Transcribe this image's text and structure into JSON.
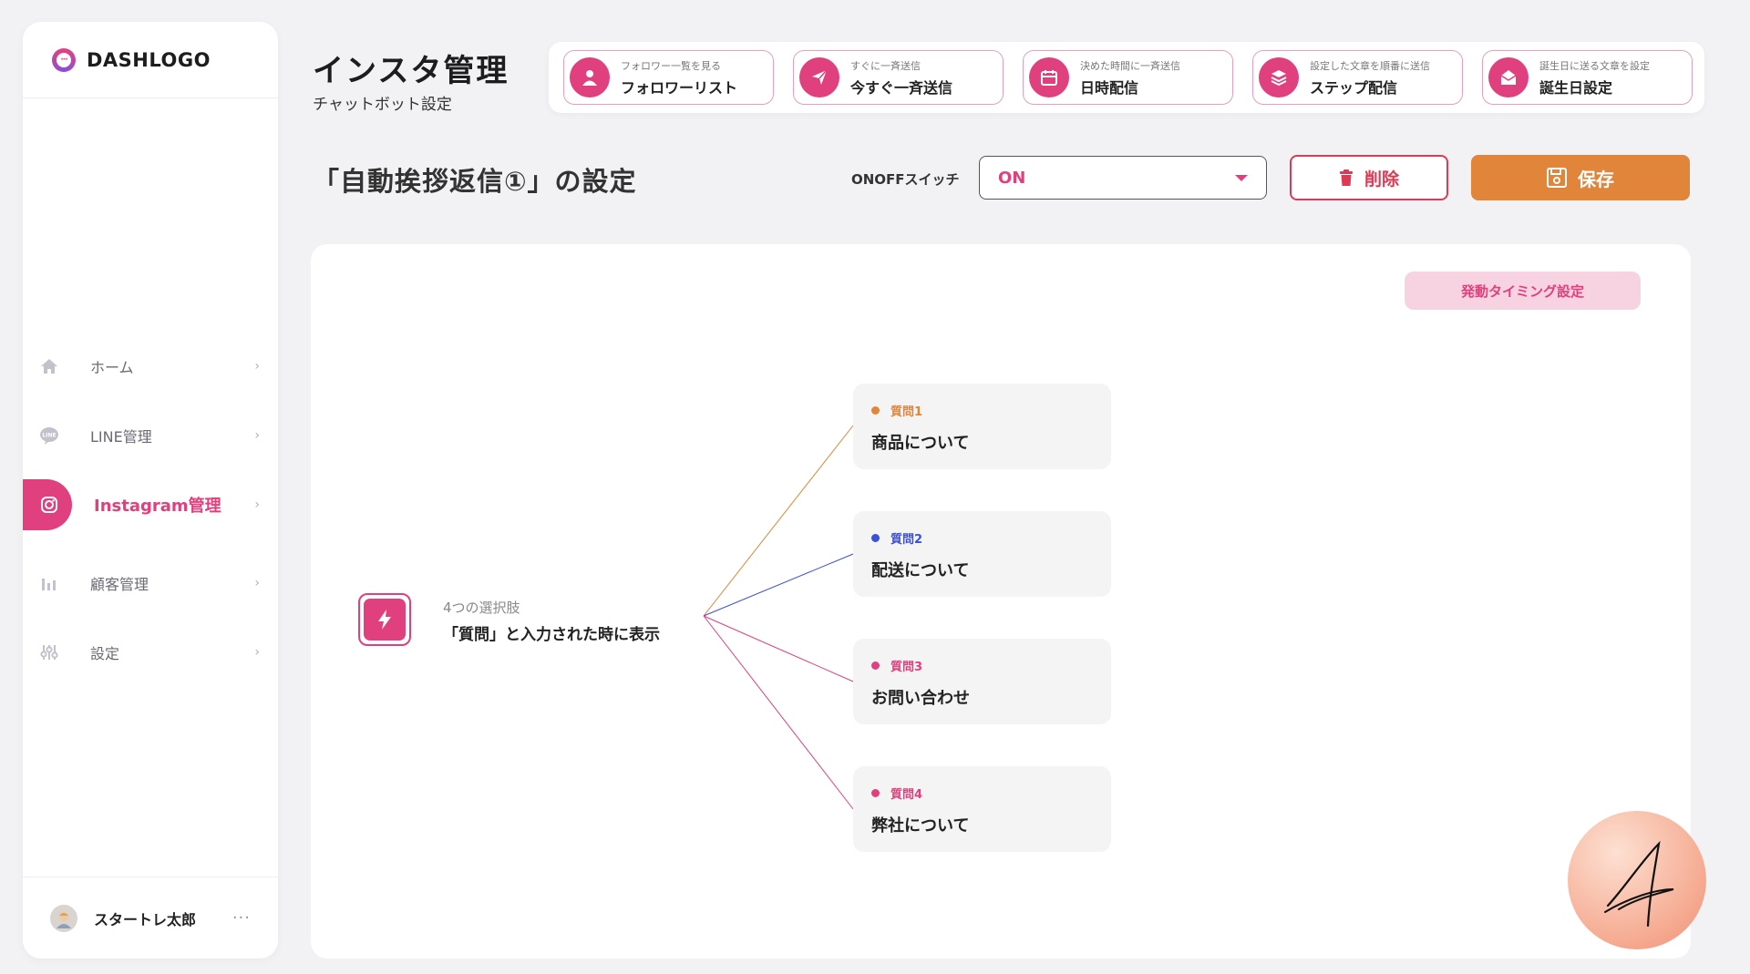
{
  "brand": {
    "logo_text": "DASHLOGO"
  },
  "sidebar": {
    "items": [
      {
        "label": "ホーム",
        "icon": "home-icon"
      },
      {
        "label": "LINE管理",
        "icon": "line-icon"
      },
      {
        "label": "Instagram管理",
        "icon": "instagram-icon",
        "active": true
      },
      {
        "label": "顧客管理",
        "icon": "bar-chart-icon"
      },
      {
        "label": "設定",
        "icon": "sliders-icon"
      }
    ],
    "user": {
      "name": "スタートレ太郎",
      "more": "···"
    }
  },
  "header": {
    "title": "インスタ管理",
    "subtitle": "チャットボット設定"
  },
  "quick_actions": [
    {
      "sub": "フォロワー一覧を見る",
      "label": "フォロワーリスト",
      "icon": "user-icon"
    },
    {
      "sub": "すぐに一斉送信",
      "label": "今すぐ一斉送信",
      "icon": "send-icon"
    },
    {
      "sub": "決めた時間に一斉送信",
      "label": "日時配信",
      "icon": "calendar-icon"
    },
    {
      "sub": "設定した文章を順番に送信",
      "label": "ステップ配信",
      "icon": "layers-icon"
    },
    {
      "sub": "誕生日に送る文章を設定",
      "label": "誕生日設定",
      "icon": "mail-open-icon"
    }
  ],
  "settings": {
    "title": "「自動挨拶返信①」の設定",
    "onoff_label": "ONOFFスイッチ",
    "onoff_value": "ON",
    "delete_label": "削除",
    "save_label": "保存"
  },
  "flow": {
    "timing_button": "発動タイミング設定",
    "trigger_sub": "4つの選択肢",
    "trigger_main": "「質問」と入力された時に表示",
    "questions": [
      {
        "tag": "質問1",
        "text": "商品について",
        "color": "#e0853a"
      },
      {
        "tag": "質問2",
        "text": "配送について",
        "color": "#3b4fd8"
      },
      {
        "tag": "質問3",
        "text": "お問い合わせ",
        "color": "#e0407e"
      },
      {
        "tag": "質問4",
        "text": "弊社について",
        "color": "#e0407e"
      }
    ]
  },
  "colors": {
    "accent": "#e0407e",
    "save": "#e0853a",
    "delete": "#dc3a55"
  }
}
